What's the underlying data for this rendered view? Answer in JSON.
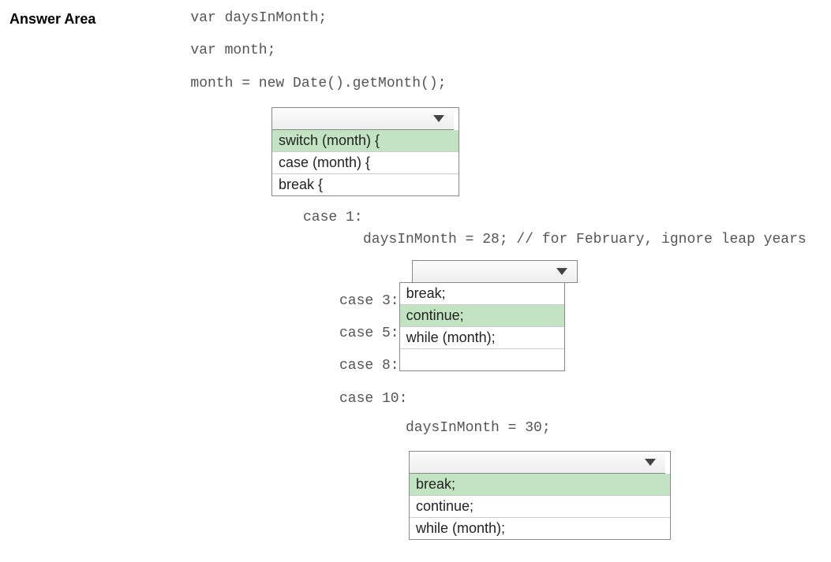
{
  "title": "Answer Area",
  "code": {
    "line1": "var daysInMonth;",
    "line2": "var month;",
    "line3": "month = new Date().getMonth();",
    "case1": "case 1:",
    "feb": "daysInMonth = 28; // for February, ignore leap years",
    "case3": "case 3:",
    "case5": "case 5:",
    "case8": "case 8:",
    "case10": "case 10:",
    "d30": "daysInMonth = 30;"
  },
  "dropdown1": {
    "selected": "",
    "options": [
      "switch (month) {",
      "case (month) {",
      "break {"
    ],
    "highlighted": 0
  },
  "dropdown2": {
    "selected": "",
    "options": [
      "break;",
      "continue;",
      "while (month);"
    ],
    "highlighted": 1
  },
  "dropdown3": {
    "selected": "",
    "options": [
      "break;",
      "continue;",
      "while (month);"
    ],
    "highlighted": 0
  }
}
